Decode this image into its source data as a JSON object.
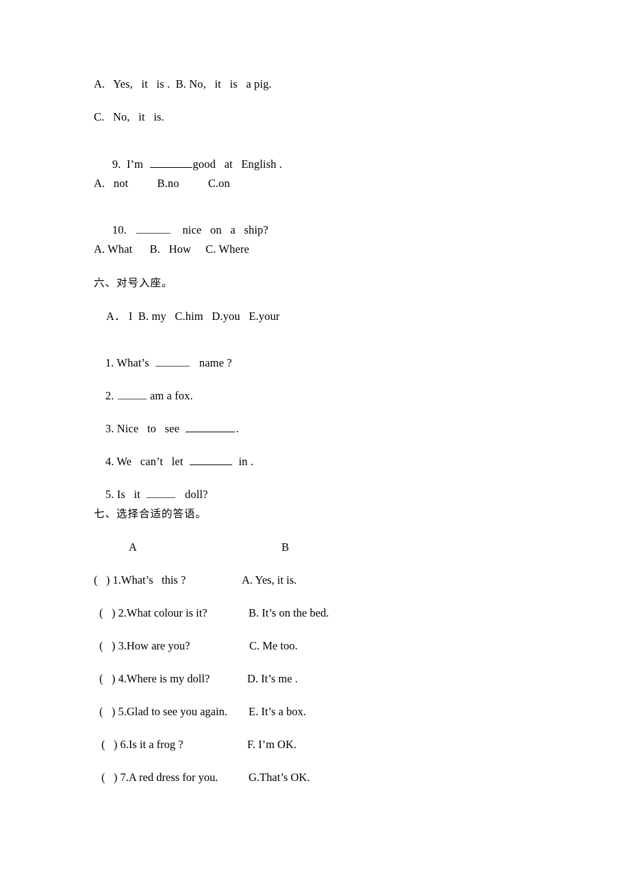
{
  "document": {
    "type": "english-worksheet",
    "language_mix": "english-chinese",
    "background_color": "#ffffff",
    "text_color": "#000000"
  },
  "multiple_choice_tail": {
    "q8_options_line1": "A.   Yes,   it   is .  B. No,   it   is   a pig.",
    "q8_options_line2": "C.   No,   it   is.",
    "q9": {
      "number": "9.",
      "before_blank": "I’m",
      "after_blank": "good   at   English ."
    },
    "q9_options": "A.   not          B.no          C.on",
    "q10": {
      "number": "10.",
      "after_blank": "nice   on   a   ship?"
    },
    "q10_options": "A. What      B.   How     C. Where"
  },
  "section_six": {
    "heading": "六、对号入座。",
    "word_bank": "A． I  B. my   C.him   D.you   E.your",
    "items": [
      {
        "number": "1.",
        "before_blank": "What’s",
        "after_blank": "name ?"
      },
      {
        "number": "2.",
        "before_blank": "",
        "after_blank": "am a fox."
      },
      {
        "number": "3.",
        "before_blank": "Nice   to   see",
        "after_blank": "."
      },
      {
        "number": "4.",
        "before_blank": "We   can’t   let",
        "after_blank": "in ."
      },
      {
        "number": "5.",
        "before_blank": "Is   it",
        "after_blank": "doll?"
      }
    ]
  },
  "section_seven": {
    "heading": "七、选择合适的答语。",
    "column_a_header": "A",
    "column_b_header": "B",
    "pairs": [
      {
        "bracket": "(   )",
        "number": "1.",
        "question": "What’s   this ?",
        "answer": "A. Yes, it is."
      },
      {
        "bracket": "(   )",
        "number": "2.",
        "question": "What colour is it?",
        "answer": "B. It’s on the bed."
      },
      {
        "bracket": "(   )",
        "number": "3.",
        "question": "How are you?",
        "answer": "C. Me too."
      },
      {
        "bracket": "(   )",
        "number": "4.",
        "question": "Where is my doll?",
        "answer": "D. It’s me ."
      },
      {
        "bracket": "(   )",
        "number": "5.",
        "question": "Glad to see you again.",
        "answer": "E. It’s a box."
      },
      {
        "bracket": "(   )",
        "number": "6.",
        "question": "Is it a frog ?",
        "answer": "F. I’m OK."
      },
      {
        "bracket": "(   )",
        "number": "7.",
        "question": "A red dress for you.",
        "answer": "G.That’s OK."
      }
    ]
  }
}
